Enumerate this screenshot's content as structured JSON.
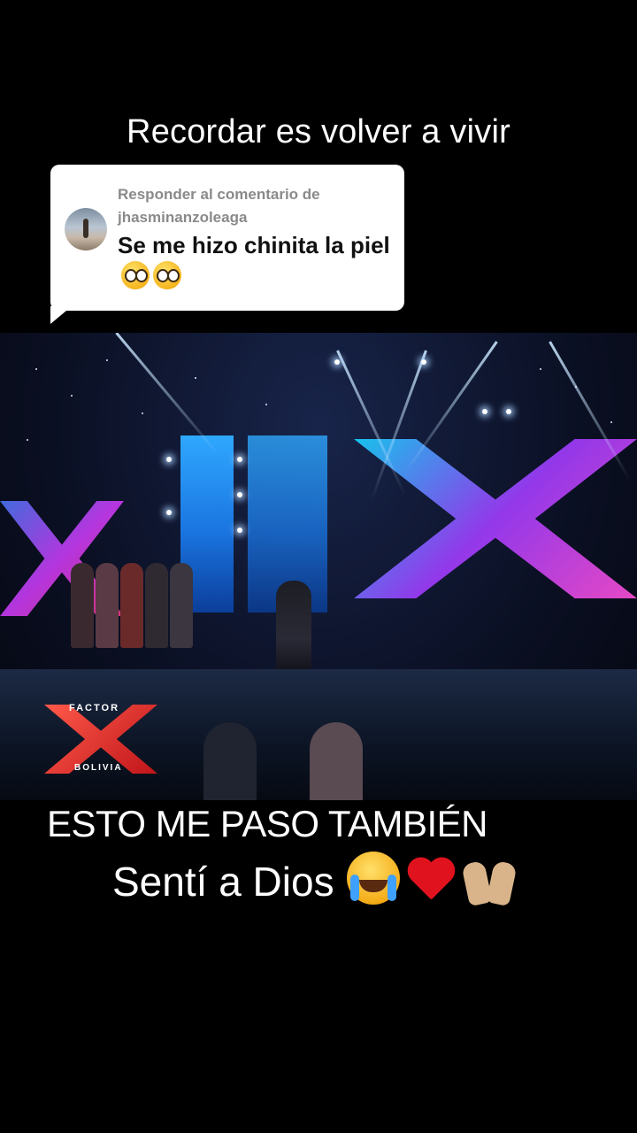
{
  "top_caption": "Recordar es volver a vivir",
  "reply": {
    "meta_line1": "Responder al comentario de",
    "username": "jhasminanzoleaga",
    "text": "Se me hizo chinita la piel",
    "emojis": [
      "pleading-face-emoji",
      "pleading-face-emoji"
    ]
  },
  "video": {
    "logo_top": "FACTOR",
    "logo_bottom": "BOLIVIA"
  },
  "overlay": {
    "line1": "ESTO ME PASO TAMBIÉN",
    "line2": "Sentí a Dios",
    "emojis": [
      "loudly-crying-face-emoji",
      "red-heart-emoji",
      "raising-hands-emoji"
    ]
  }
}
